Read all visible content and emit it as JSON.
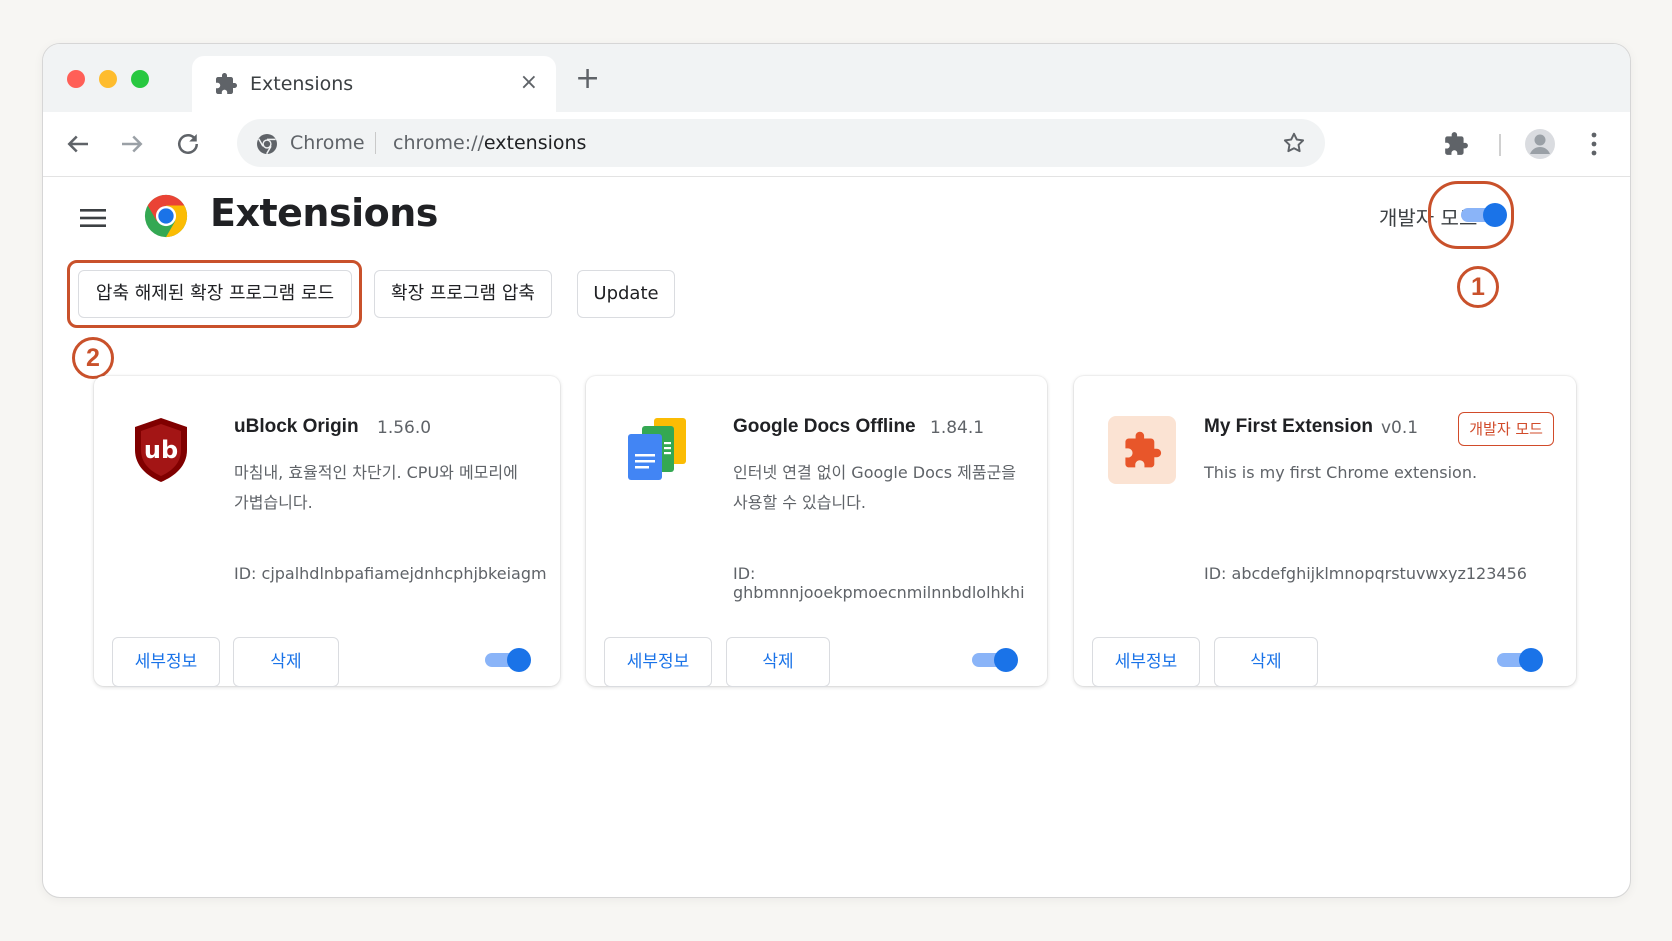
{
  "browser": {
    "tab_title": "Extensions",
    "new_tab_symbol": "+",
    "close_symbol": "×",
    "omnibox_label": "Chrome",
    "url_prefix": "chrome://",
    "url_path": "extensions"
  },
  "page": {
    "title": "Extensions",
    "developer_mode_label": "개발자 모드",
    "developer_mode_on": true
  },
  "actions": {
    "load_unpacked": "압축 해제된 확장 프로그램 로드",
    "pack_extension": "확장 프로그램 압축",
    "update": "Update"
  },
  "callouts": {
    "one": "1",
    "two": "2"
  },
  "extensions": [
    {
      "name": "uBlock Origin",
      "version": "1.56.0",
      "description": "마침내, 효율적인 차단기. CPU와 메모리에 가볍습니다.",
      "id": "ID: cjpalhdlnbpafiamejdnhcphjbkeiagm",
      "icon_text": "ub",
      "details_label": "세부정보",
      "remove_label": "삭제",
      "enabled": true
    },
    {
      "name": "Google Docs Offline",
      "version": "1.84.1",
      "description": "인터넷 연결 없이 Google Docs 제품군을 사용할 수 있습니다.",
      "id": "ID: ghbmnnjooekpmoecnmilnnbdlolhkhi",
      "details_label": "세부정보",
      "remove_label": "삭제",
      "enabled": true
    },
    {
      "name": "My First Extension",
      "version": "v0.1",
      "badge": "개발자 모드",
      "description": "This is my first Chrome extension.",
      "id": "ID: abcdefghijklmnopqrstuvwxyz123456",
      "details_label": "세부정보",
      "remove_label": "삭제",
      "enabled": true
    }
  ],
  "colors": {
    "accent": "#1a73e8",
    "toggle_knob": "#1a73e8",
    "toggle_track": "#8ab4f8",
    "callout": "#c9512b",
    "window_close": "#ff5f57",
    "window_minimize": "#febc2e",
    "window_maximize": "#28c840"
  },
  "icons": [
    "puzzle-icon",
    "close-icon",
    "plus-icon",
    "back-arrow-icon",
    "forward-arrow-icon",
    "reload-icon",
    "chrome-icon",
    "star-icon",
    "extensions-icon",
    "avatar-icon",
    "kebab-menu-icon",
    "hamburger-menu-icon",
    "chrome-logo-icon",
    "ublock-shield-icon",
    "google-docs-icon",
    "orange-puzzle-icon"
  ]
}
